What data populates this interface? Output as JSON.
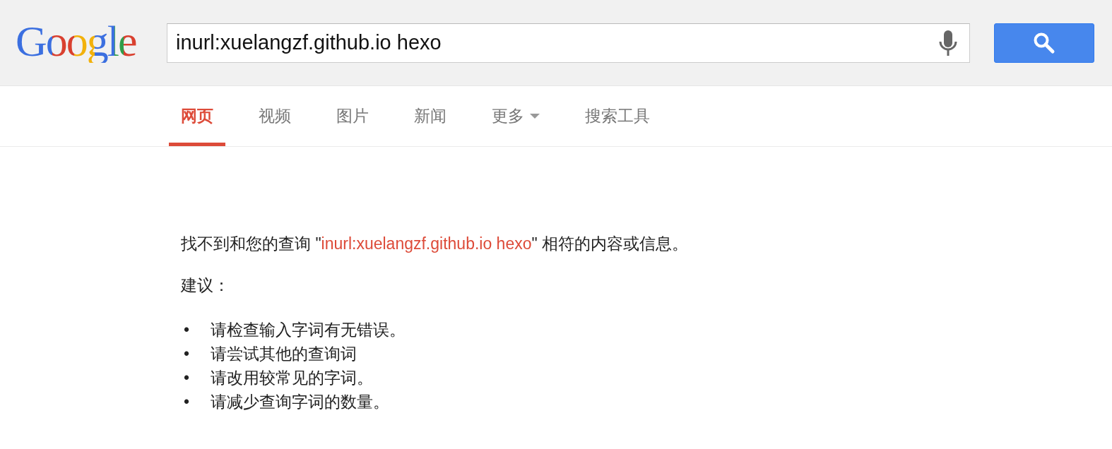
{
  "logo": {
    "text": "Google"
  },
  "search": {
    "value": "inurl:xuelangzf.github.io hexo"
  },
  "tabs": [
    {
      "label": "网页",
      "selected": true
    },
    {
      "label": "视频",
      "selected": false
    },
    {
      "label": "图片",
      "selected": false
    },
    {
      "label": "新闻",
      "selected": false
    },
    {
      "label": "更多",
      "selected": false,
      "kind": "dropdown"
    },
    {
      "label": "搜索工具",
      "selected": false
    }
  ],
  "message": {
    "prefix": "找不到和您的查询 \"",
    "query": "inurl:xuelangzf.github.io hexo",
    "suffix": "\" 相符的内容或信息。"
  },
  "suggestions_heading": "建议：",
  "suggestions": [
    {
      "bullet": "•",
      "text": "请检查输入字词有无错误。"
    },
    {
      "bullet": "•",
      "text": "请尝试其他的查询词"
    },
    {
      "bullet": "•",
      "text": "请改用较常见的字词。"
    },
    {
      "bullet": "•",
      "text": "请减少查询字词的数量。"
    }
  ]
}
